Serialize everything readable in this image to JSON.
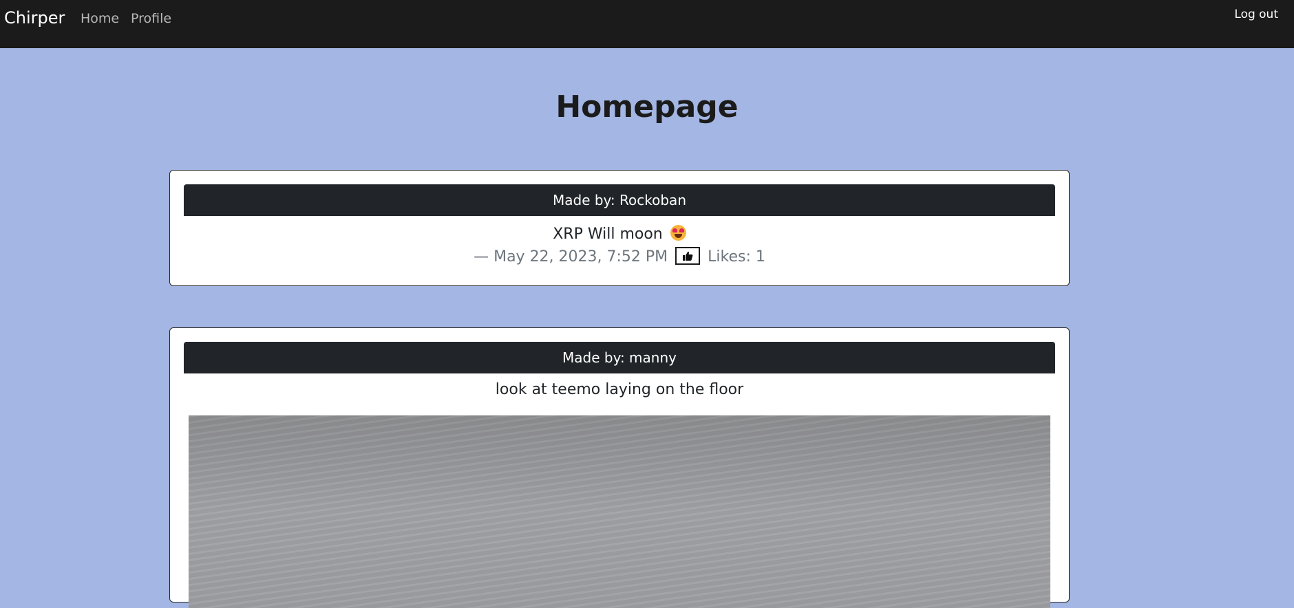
{
  "navbar": {
    "brand": "Chirper",
    "links": [
      "Home",
      "Profile"
    ],
    "logout_label": "Log out"
  },
  "page": {
    "title": "Homepage"
  },
  "posts": [
    {
      "author_label": "Made by: Rockoban",
      "text": "XRP Will moon",
      "emoji": "smiling-face-with-heart-eyes",
      "meta_prefix": "— May 22, 2023, 7:52 PM",
      "likes_label": "Likes: 1"
    },
    {
      "author_label": "Made by: manny",
      "text": "look at teemo laying on the floor"
    }
  ],
  "colors": {
    "page_background": "#a4b6e3",
    "navbar": "#1b1b1b",
    "card_header": "#212529"
  }
}
